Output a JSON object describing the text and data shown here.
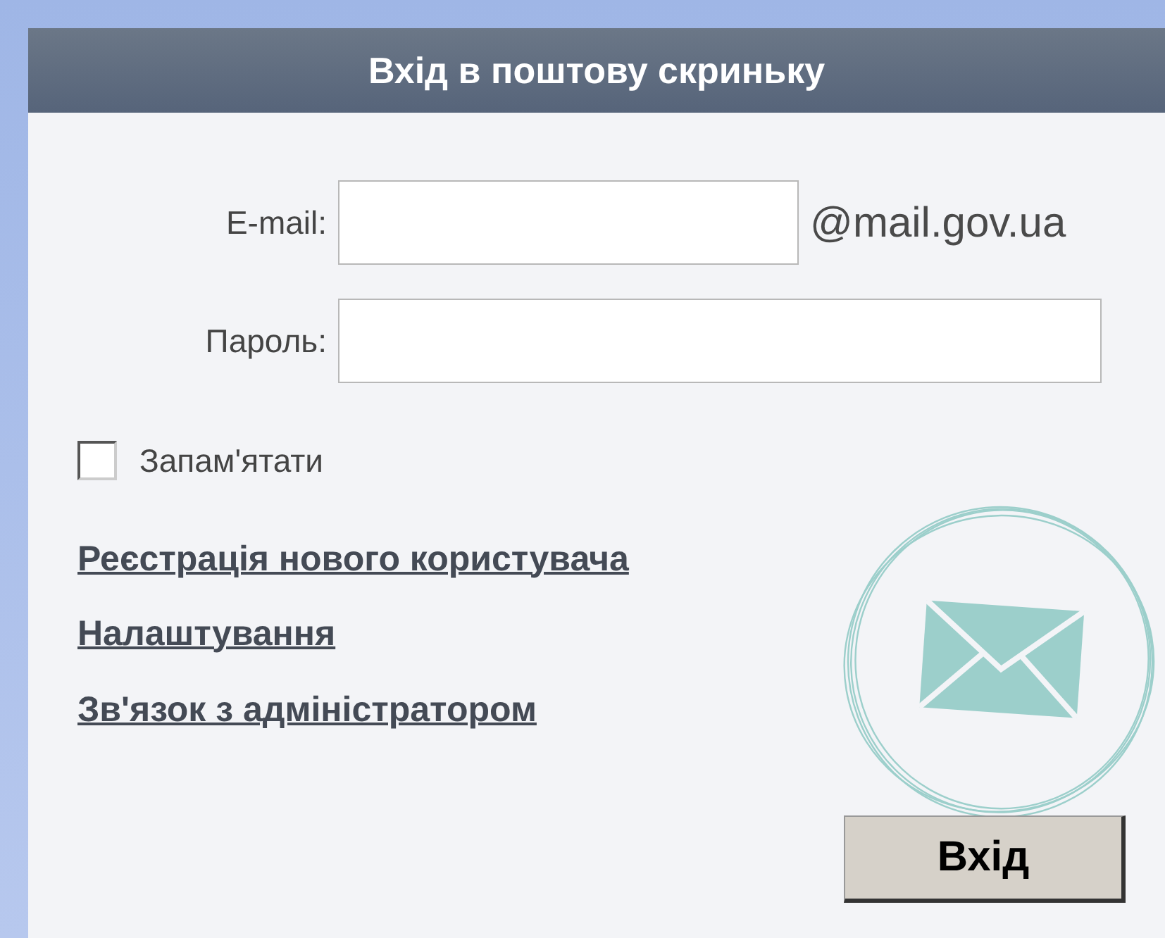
{
  "header": {
    "title": "Вхід в поштову скриньку"
  },
  "email": {
    "label": "E-mail:",
    "domain": "@mail.gov.ua"
  },
  "password": {
    "label": "Пароль:"
  },
  "remember": {
    "label": "Запам'ятати",
    "checked": false
  },
  "links": [
    "Реєстрація нового користувача",
    "Налаштування",
    "Зв'язок з адміністратором"
  ],
  "submit": {
    "label": "Вхід"
  }
}
